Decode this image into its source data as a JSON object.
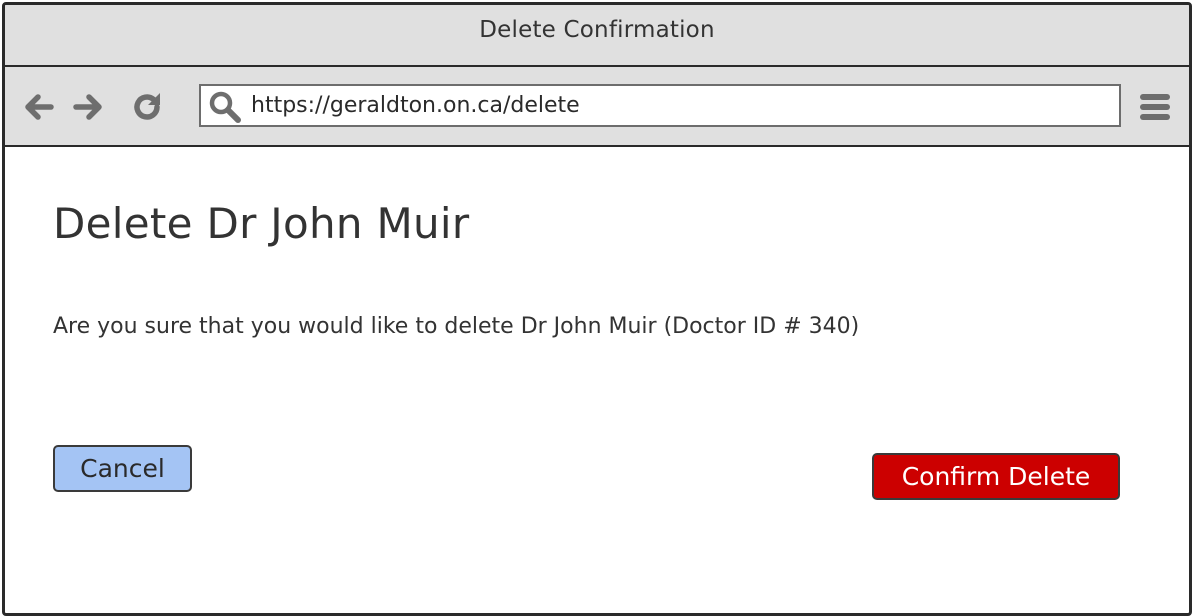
{
  "window": {
    "title": "Delete Confirmation"
  },
  "toolbar": {
    "back_icon": "arrow-left-icon",
    "forward_icon": "arrow-right-icon",
    "reload_icon": "reload-icon",
    "search_icon": "search-icon",
    "menu_icon": "hamburger-menu-icon",
    "url": "https://geraldton.on.ca/delete"
  },
  "page": {
    "title": "Delete Dr John Muir",
    "message": "Are you sure that you would like to delete Dr John Muir (Doctor ID # 340)"
  },
  "actions": {
    "cancel_label": "Cancel",
    "confirm_label": "Confirm Delete"
  },
  "colors": {
    "chrome_bg": "#e0e0e0",
    "cancel_bg": "#a4c4f4",
    "confirm_bg": "#cc0000",
    "text": "#333333"
  }
}
